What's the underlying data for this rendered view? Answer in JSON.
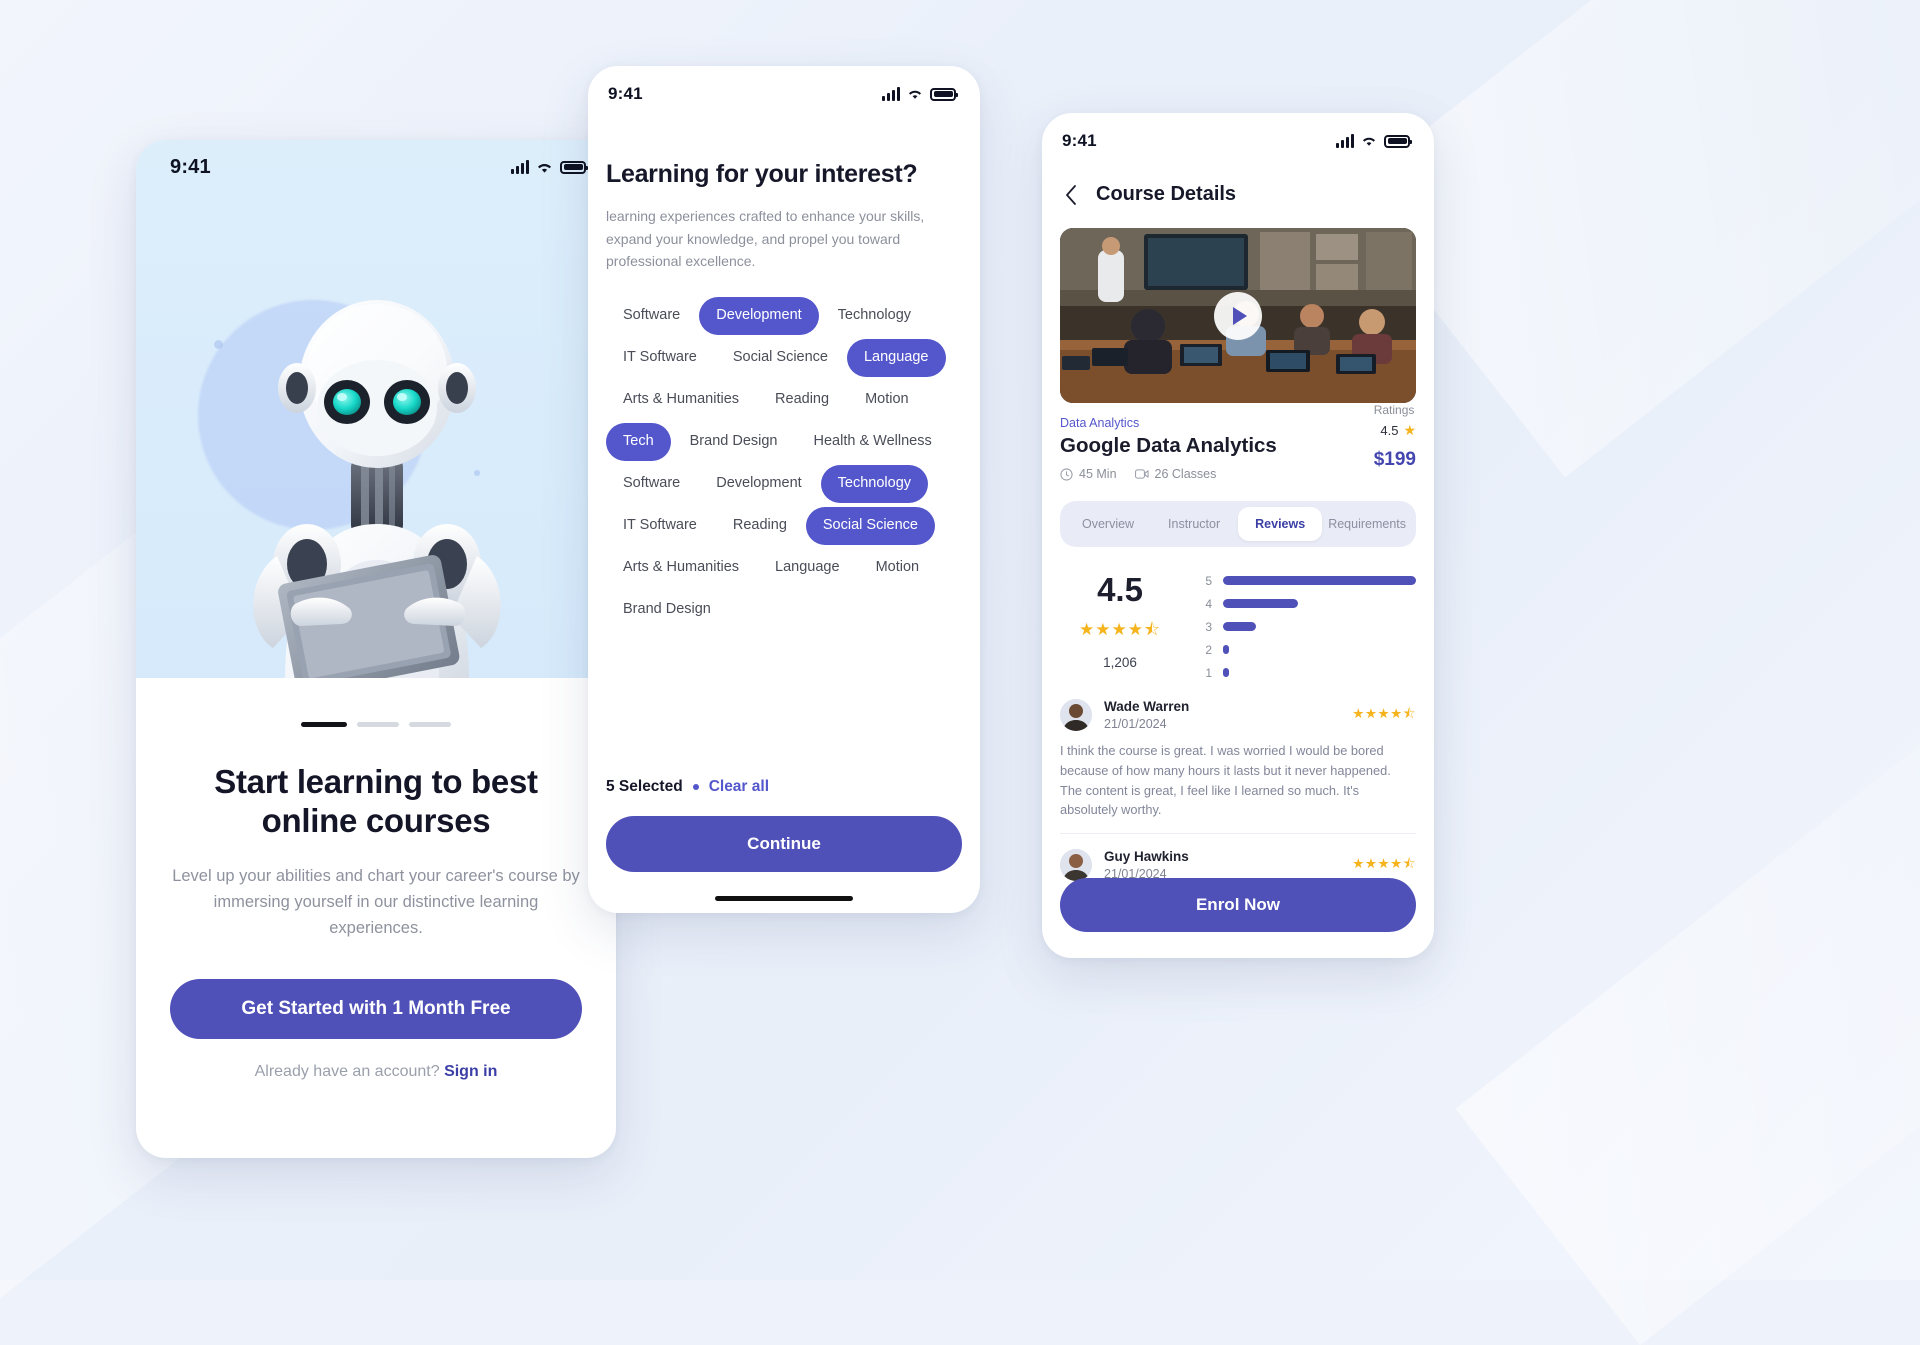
{
  "brand": {
    "primary": "#4f51b8",
    "chip_selected": "#5457cc",
    "star": "#f5b31c",
    "link": "#3b3fa6"
  },
  "onboarding": {
    "status": {
      "time": "9:41",
      "signal_icon": "signal-bars-icon",
      "wifi_icon": "wifi-icon",
      "battery_icon": "battery-icon"
    },
    "hero_icon": "robot-with-tablet-illustration",
    "pagination": {
      "total": 3,
      "active_index": 0
    },
    "title": "Start learning to best online courses",
    "subtitle": "Level up your abilities and chart your career's course by immersing yourself in our distinctive learning experiences.",
    "cta_label": "Get Started with 1 Month Free",
    "signin_prefix": "Already have an account? ",
    "signin_link": "Sign in"
  },
  "interests": {
    "status": {
      "time": "9:41"
    },
    "title": "Learning for your interest?",
    "subtitle": "learning experiences crafted to enhance your skills, expand your knowledge, and propel you toward professional excellence.",
    "chips": [
      {
        "label": "Software",
        "selected": false
      },
      {
        "label": "Development",
        "selected": true
      },
      {
        "label": "Technology",
        "selected": false
      },
      {
        "label": "IT Software",
        "selected": false
      },
      {
        "label": "Social Science",
        "selected": false
      },
      {
        "label": "Language",
        "selected": true
      },
      {
        "label": "Arts & Humanities",
        "selected": false
      },
      {
        "label": "Reading",
        "selected": false
      },
      {
        "label": "Motion",
        "selected": false
      },
      {
        "label": "Tech",
        "selected": true
      },
      {
        "label": "Brand Design",
        "selected": false
      },
      {
        "label": "Health & Wellness",
        "selected": false
      },
      {
        "label": "Software",
        "selected": false
      },
      {
        "label": "Development",
        "selected": false
      },
      {
        "label": "Technology",
        "selected": true
      },
      {
        "label": "IT Software",
        "selected": false
      },
      {
        "label": "Reading",
        "selected": false
      },
      {
        "label": "Social Science",
        "selected": true
      },
      {
        "label": "Arts & Humanities",
        "selected": false
      },
      {
        "label": "Language",
        "selected": false
      },
      {
        "label": "Motion",
        "selected": false
      },
      {
        "label": "Brand Design",
        "selected": false
      }
    ],
    "selected_text": "5 Selected",
    "clear_all_label": "Clear all",
    "continue_label": "Continue"
  },
  "course": {
    "status": {
      "time": "9:41"
    },
    "back_icon": "chevron-left-icon",
    "header_title": "Course Details",
    "video": {
      "thumbnail": "classroom-presentation-photo",
      "play_icon": "play-icon"
    },
    "category": "Data Analytics",
    "title": "Google Data Analytics",
    "duration": "45 Min",
    "duration_icon": "clock-icon",
    "classes": "26 Classes",
    "classes_icon": "video-lesson-icon",
    "ratings_label": "Ratings",
    "rating_value": "4.5",
    "rating_star_icon": "star-icon",
    "price": "$199",
    "tabs": [
      {
        "label": "Overview",
        "active": false
      },
      {
        "label": "Instructor",
        "active": false
      },
      {
        "label": "Reviews",
        "active": true
      },
      {
        "label": "Requirements",
        "active": false
      }
    ],
    "rating_summary": {
      "average": "4.5",
      "stars_filled": 4.5,
      "total_reviews": "1,206",
      "breakdown": [
        {
          "stars": "5",
          "percent": 100
        },
        {
          "stars": "4",
          "percent": 39
        },
        {
          "stars": "3",
          "percent": 17
        },
        {
          "stars": "2",
          "percent": 3
        },
        {
          "stars": "1",
          "percent": 3
        }
      ]
    },
    "reviews": [
      {
        "avatar": "avatar-wade-warren",
        "name": "Wade Warren",
        "date": "21/01/2024",
        "stars": 4.5,
        "text": "I think the course is great. I was worried I would be bored because of how many hours it lasts but it never happened. The content is great, I feel like I learned so much. It's absolutely worthy."
      },
      {
        "avatar": "avatar-guy-hawkins",
        "name": "Guy Hawkins",
        "date": "21/01/2024",
        "stars": 4.5,
        "text": ""
      }
    ],
    "enrol_label": "Enrol Now"
  }
}
